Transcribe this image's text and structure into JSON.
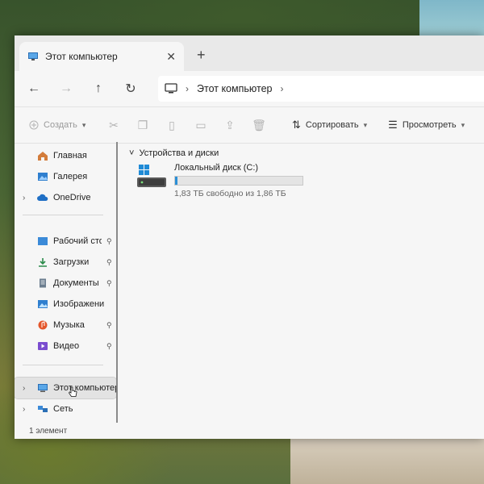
{
  "window": {
    "tab_title": "Этот компьютер",
    "tab_close": "✕",
    "new_tab": "+"
  },
  "nav": {
    "back": "←",
    "forward": "→",
    "up": "↑",
    "refresh": "↻",
    "address_segment": "Этот компьютер",
    "chevron": "›"
  },
  "toolbar": {
    "create_label": "Создать",
    "sort_label": "Сортировать",
    "view_label": "Просмотреть",
    "icons": [
      "cut-icon",
      "copy-icon",
      "paste-icon",
      "rename-icon",
      "share-icon",
      "delete-icon"
    ]
  },
  "sidebar": {
    "items": [
      {
        "label": "Главная",
        "icon": "home-icon"
      },
      {
        "label": "Галерея",
        "icon": "gallery-icon"
      },
      {
        "label": "OneDrive",
        "icon": "cloud-icon"
      },
      {
        "label": "Рабочий сто",
        "icon": "desktop-icon"
      },
      {
        "label": "Загрузки",
        "icon": "download-icon"
      },
      {
        "label": "Документы",
        "icon": "documents-icon"
      },
      {
        "label": "Изображени",
        "icon": "pictures-icon"
      },
      {
        "label": "Музыка",
        "icon": "music-icon"
      },
      {
        "label": "Видео",
        "icon": "video-icon"
      },
      {
        "label": "Этот компьютер",
        "icon": "computer-icon"
      },
      {
        "label": "Сеть",
        "icon": "network-icon"
      }
    ],
    "pin_glyph": "📌",
    "expand_glyph": "›"
  },
  "content": {
    "section_title": "Устройства и диски",
    "section_chevron": "˅",
    "drive": {
      "name": "Локальный диск (C:)",
      "free_text": "1,83 ТБ свободно из 1,86 ТБ",
      "used_fraction": 0.016
    }
  },
  "status": {
    "count_text": "1 элемент"
  },
  "colors": {
    "accent": "#2b8fd6",
    "window_bg": "#f6f6f6"
  }
}
